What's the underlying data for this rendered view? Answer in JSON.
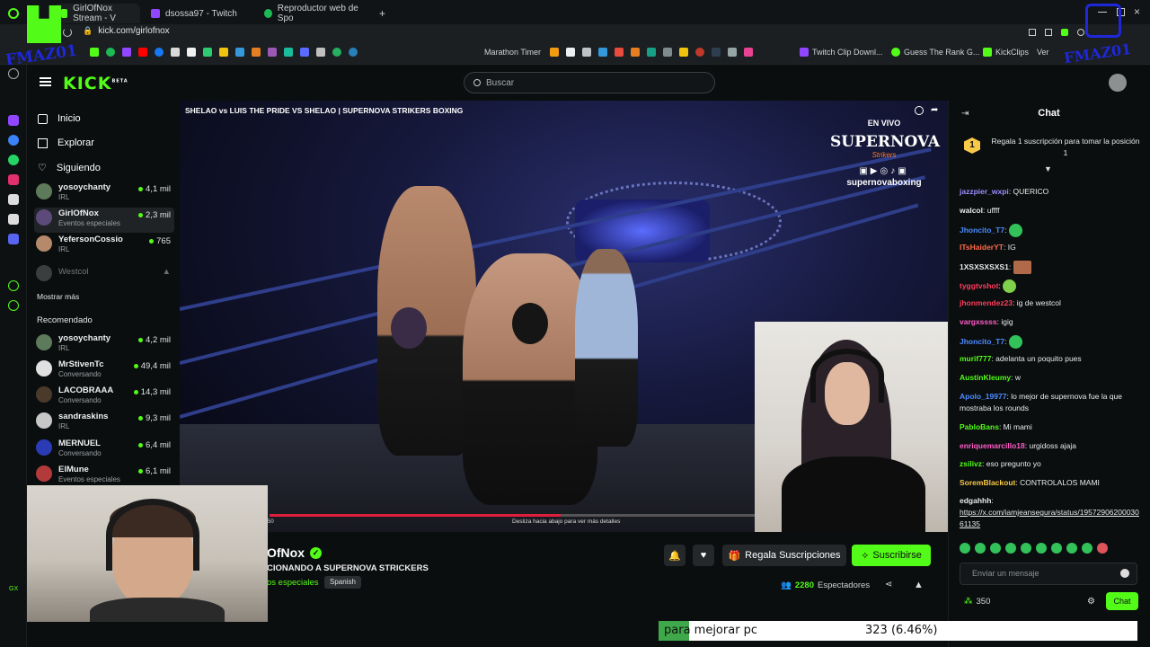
{
  "browser": {
    "tabs": [
      {
        "label": "GirlOfNox Stream - V",
        "active": true,
        "color": "#53fc18"
      },
      {
        "label": "dsossa97 - Twitch",
        "active": false,
        "color": "#9146ff"
      },
      {
        "label": "Reproductor web de Spo",
        "active": false,
        "color": "#1db954"
      }
    ],
    "new_tab": "+",
    "url": "kick.com/girlofnox",
    "bookmarks": [
      "Marathon Timer",
      "Twitch Clip Downl...",
      "Guess The Rank G...",
      "KickClips",
      "Ver"
    ]
  },
  "overlay_watermark": "FMAZ01",
  "kick": {
    "logo": "KICK",
    "logo_badge": "BETA",
    "search_placeholder": "Buscar",
    "nav": [
      {
        "label": "Inicio",
        "icon": "home-icon"
      },
      {
        "label": "Explorar",
        "icon": "compass-icon"
      },
      {
        "label": "Siguiendo",
        "icon": "heart-icon"
      }
    ],
    "following": [
      {
        "name": "yosoychanty",
        "sub": "IRL",
        "viewers": "4,1 mil"
      },
      {
        "name": "GirlOfNox",
        "sub": "Eventos especiales",
        "viewers": "2,3 mil"
      },
      {
        "name": "YefersonCossio",
        "sub": "IRL",
        "viewers": "765"
      },
      {
        "name": "Westcol",
        "sub": "",
        "viewers": ""
      }
    ],
    "show_more": "Mostrar más",
    "recommended_label": "Recomendado",
    "recommended": [
      {
        "name": "yosoychanty",
        "sub": "IRL",
        "viewers": "4,2 mil"
      },
      {
        "name": "MrStivenTc",
        "sub": "Conversando",
        "viewers": "49,4 mil"
      },
      {
        "name": "LACOBRAAA",
        "sub": "Conversando",
        "viewers": "14,3 mil"
      },
      {
        "name": "sandraskins",
        "sub": "IRL",
        "viewers": "9,3 mil"
      },
      {
        "name": "MERNUEL",
        "sub": "Conversando",
        "viewers": "6,4 mil"
      },
      {
        "name": "ElMune",
        "sub": "Eventos especiales",
        "viewers": "6,1 mil"
      }
    ]
  },
  "player": {
    "title": "SHELAO vs LUIS THE PRIDE VS SHELAO | SUPERNOVA STRIKERS BOXING",
    "live_label": "EN VIVO",
    "brand": "SUPERNOVA",
    "brand_sub": "Strikers",
    "handle": "supernovaboxing",
    "swipe_hint": "Desliza hacia abajo para ver más detalles",
    "progress": 0.6,
    "time_label": "50"
  },
  "stream": {
    "channel_name": "OfNox",
    "title": "CIONANDO A SUPERNOVA STRICKERS",
    "category": "os especiales",
    "language": "Spanish",
    "gift_label": "Regala Suscripciones",
    "subscribe_label": "Suscribirse",
    "viewer_count": "2280",
    "viewer_label": "Espectadores"
  },
  "chat": {
    "title": "Chat",
    "pinned": "Regala 1 suscripción para tomar la posición 1",
    "pinned_rank": "1",
    "messages": [
      {
        "user": "jazzpier_wxpi",
        "text": "QUERICO",
        "color": "#9b8cff"
      },
      {
        "user": "walcol",
        "text": "uffff",
        "color": "#e8eaeb"
      },
      {
        "user": "Jhoncito_T7",
        "text": "",
        "color": "#4a8cff"
      },
      {
        "user": "ITsHaiderYT",
        "text": "IG",
        "color": "#ff6a4a"
      },
      {
        "user": "1XSXSXSXS1",
        "text": "",
        "color": "#e8eaeb"
      },
      {
        "user": "tyggtvshot",
        "text": "",
        "color": "#ff3c5c"
      },
      {
        "user": "jhonmendez23",
        "text": "ig de westcol",
        "color": "#ff3c5c"
      },
      {
        "user": "vargxssss",
        "text": "igig",
        "color": "#ff5cc8"
      },
      {
        "user": "Jhoncito_T7",
        "text": "",
        "color": "#4a8cff"
      },
      {
        "user": "murif777",
        "text": "adelanta un poquito pues",
        "color": "#53fc18"
      },
      {
        "user": "AustinKleumy",
        "text": "w",
        "color": "#53fc18"
      },
      {
        "user": "Apolo_19977",
        "text": "lo mejor de supernova fue la que mostraba los rounds",
        "color": "#4a8cff"
      },
      {
        "user": "PabloBans",
        "text": "Mi mami",
        "color": "#53fc18"
      },
      {
        "user": "enriquemarcillo18",
        "text": "urgidoss ajaja",
        "color": "#ff5cc8"
      },
      {
        "user": "zsilivz",
        "text": "eso pregunto yo",
        "color": "#53fc18"
      },
      {
        "user": "SoremBlackout",
        "text": "CONTROLALOS MAMI",
        "color": "#f7c948"
      },
      {
        "user": "edgahhh",
        "text": "https://x.com/iamjeansegura/status/1957290620003061135",
        "color": "#e8eaeb"
      }
    ],
    "input_placeholder": "Enviar un mensaje",
    "points": "350",
    "send_label": "Chat"
  },
  "goal_bar": {
    "label": "para mejorar pc",
    "value": "323 (6.46%)",
    "fill_fraction": 0.0646
  }
}
